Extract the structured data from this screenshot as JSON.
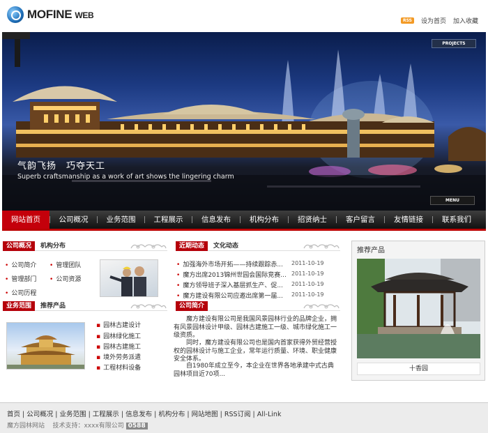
{
  "header": {
    "logo_text": "MOFINE",
    "logo_suffix": "WEB",
    "rss_label": "RSS",
    "set_home": "设为首页",
    "add_favorite": "加入收藏"
  },
  "banner": {
    "projects_label": "PROJECTS",
    "menu_label": "MENU",
    "slogan_cn": "气韵飞扬　巧夺天工",
    "slogan_en": "Superb craftsmanship as a work of art shows the lingering charm"
  },
  "nav": {
    "items": [
      "网站首页",
      "公司概况",
      "业务范围",
      "工程展示",
      "信息发布",
      "机构分布",
      "招贤纳士",
      "客户留言",
      "友情链接",
      "联系我们"
    ]
  },
  "company": {
    "tab_active": "公司概况",
    "tab_other": "机构分布",
    "links": [
      "公司简介",
      "管理团队",
      "管理部门",
      "公司资源",
      "公司历程"
    ]
  },
  "business": {
    "tab_active": "业务范围",
    "tab_other": "推荐产品",
    "items": [
      "园林古建设计",
      "园林绿化施工",
      "园林古建施工",
      "境外劳务派遣",
      "工程材料设备"
    ]
  },
  "news": {
    "tab_active": "近期动态",
    "tab_other": "文化动态",
    "items": [
      {
        "title": "加强海外市场开拓——持续跟踪赤...",
        "date": "2011-10-19"
      },
      {
        "title": "魔方出席2013锦州世园会国际竞赛...",
        "date": "2011-10-19"
      },
      {
        "title": "魔方领导班子深入基层抓生产、促...",
        "date": "2011-10-19"
      },
      {
        "title": "魔方建设有限公司应邀出席第一届...",
        "date": "2011-10-19"
      }
    ]
  },
  "intro": {
    "tab_active": "公司简介",
    "paragraphs": [
      "　　魔方建设有限公司是我国风景园林行业的品牌企业，拥有风景园林设计甲级、园林古建施工一级、城市绿化施工一级资质。",
      "　　同时，魔方建设有限公司也是国内首家获得外贸经营授权的园林设计与施工企业，常年运行质量、环境、职业健康安全体系。",
      "　　自1980年成立至今，本企业在世界各地承建中式古典园林项目近70项..."
    ]
  },
  "recommend": {
    "title": "推荐产品",
    "caption": "十香园"
  },
  "footer": {
    "links": [
      "首页",
      "公司概况",
      "业务范围",
      "工程展示",
      "信息发布",
      "机构分布",
      "网站地图",
      "RSS订阅",
      "All-Link"
    ],
    "site_name": "魔方园林网站",
    "support_label": "技术支持：xxxx有限公司",
    "badge": "0588"
  }
}
